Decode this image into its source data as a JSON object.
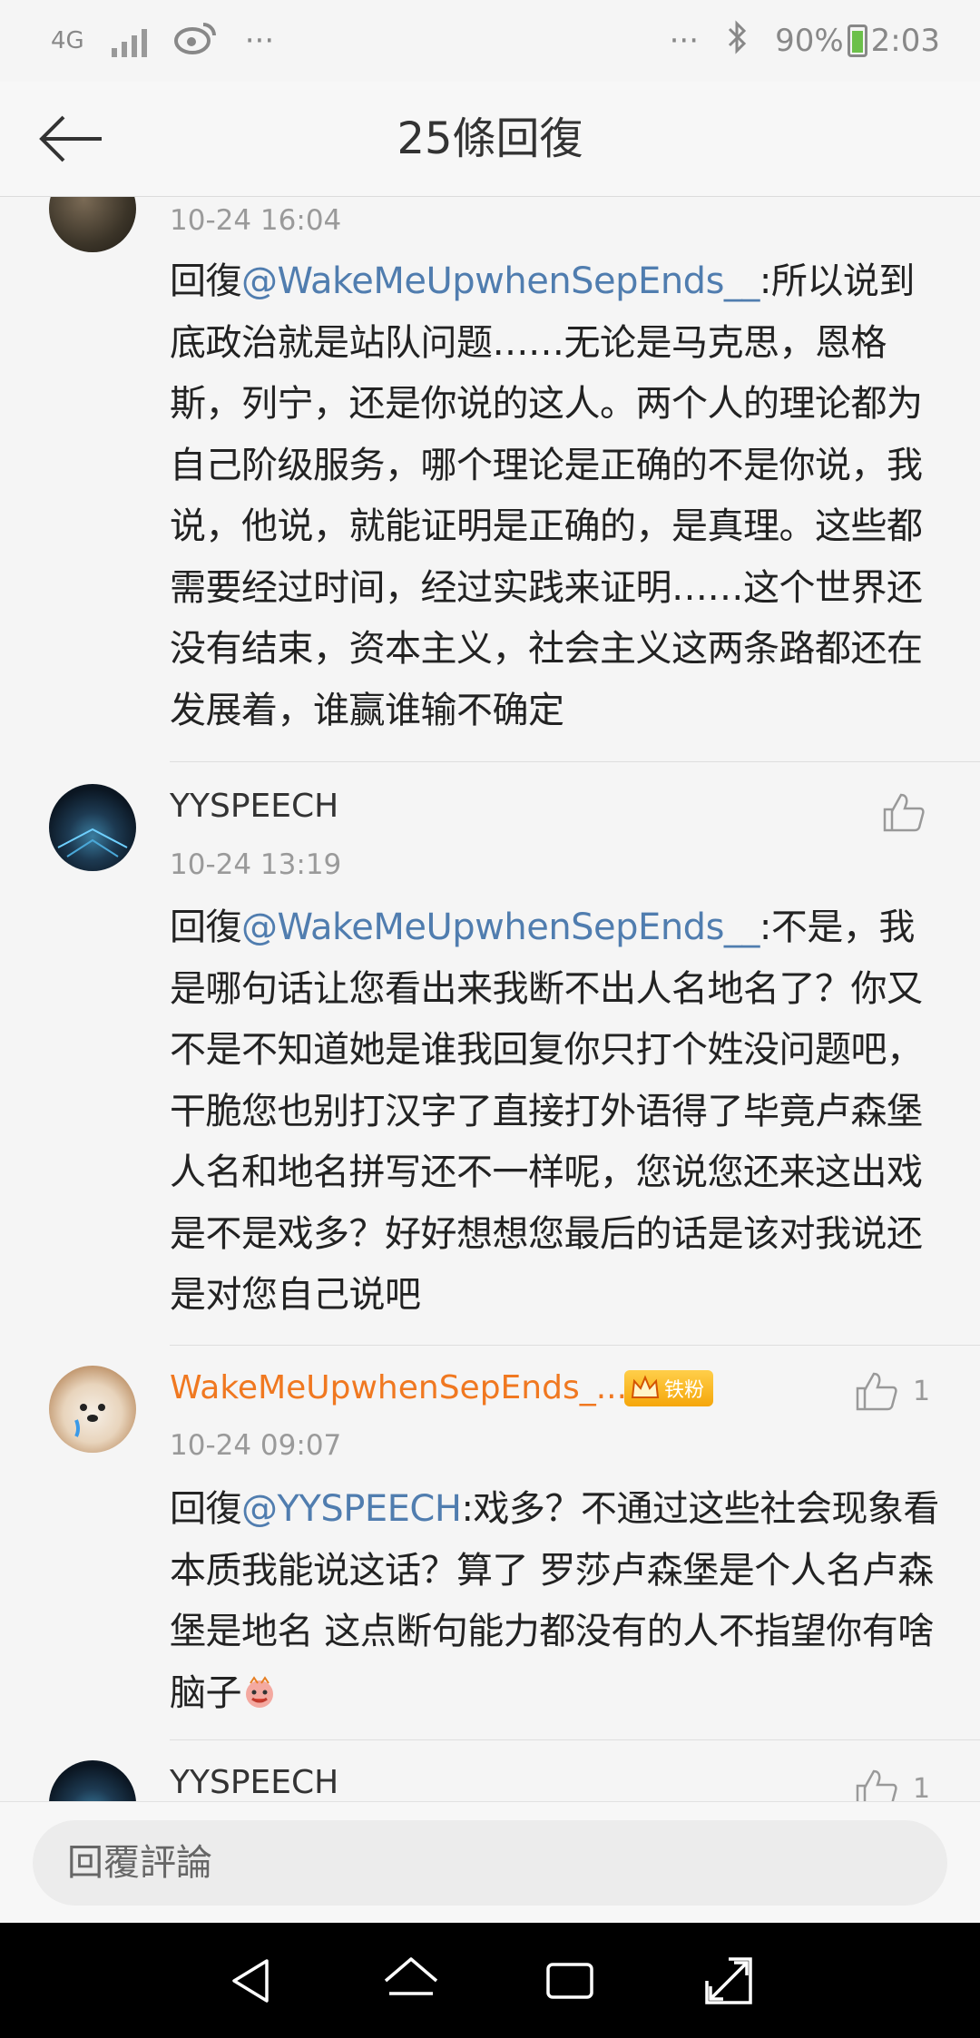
{
  "status_bar": {
    "network": "4G",
    "left_more": "···",
    "right_more": "···",
    "battery": "90%",
    "time": "2:03"
  },
  "header": {
    "title": "25條回復"
  },
  "comments": [
    {
      "time": "10-24 16:04",
      "reply_prefix": "回復",
      "mention": "@WakeMeUpwhenSepEnds__",
      "text": ":所以说到底政治就是站队问题……无论是马克思，恩格斯，列宁，还是你说的这人。两个人的理论都为自己阶级服务，哪个理论是正确的不是你说，我说，他说，就能证明是正确的，是真理。这些都需要经过时间，经过实践来证明……这个世界还没有结束，资本主义，社会主义这两条路都还在发展着，谁赢谁输不确定"
    },
    {
      "username": "YYSPEECH",
      "time": "10-24 13:19",
      "reply_prefix": "回復",
      "mention": "@WakeMeUpwhenSepEnds__",
      "text": ":不是，我是哪句话让您看出来我断不出人名地名了？你又不是不知道她是谁我回复你只打个姓没问题吧，干脆您也别打汉字了直接打外语得了毕竟卢森堡人名和地名拼写还不一样呢，您说您还来这出戏是不是戏多？好好想想您最后的话是该对我说还是对您自己说吧"
    },
    {
      "username": "WakeMeUpwhenSepEnds_...",
      "badge": "铁粉",
      "likes": "1",
      "time": "10-24 09:07",
      "reply_prefix": "回復",
      "mention": "@YYSPEECH",
      "text": ":戏多？不通过这些社会现象看本质我能说这话？算了 罗莎卢森堡是个人名卢森堡是地名 这点断句能力都没有的人不指望你有啥脑子"
    },
    {
      "username": "YYSPEECH",
      "likes": "1"
    }
  ],
  "footer": {
    "placeholder": "回覆評論"
  }
}
